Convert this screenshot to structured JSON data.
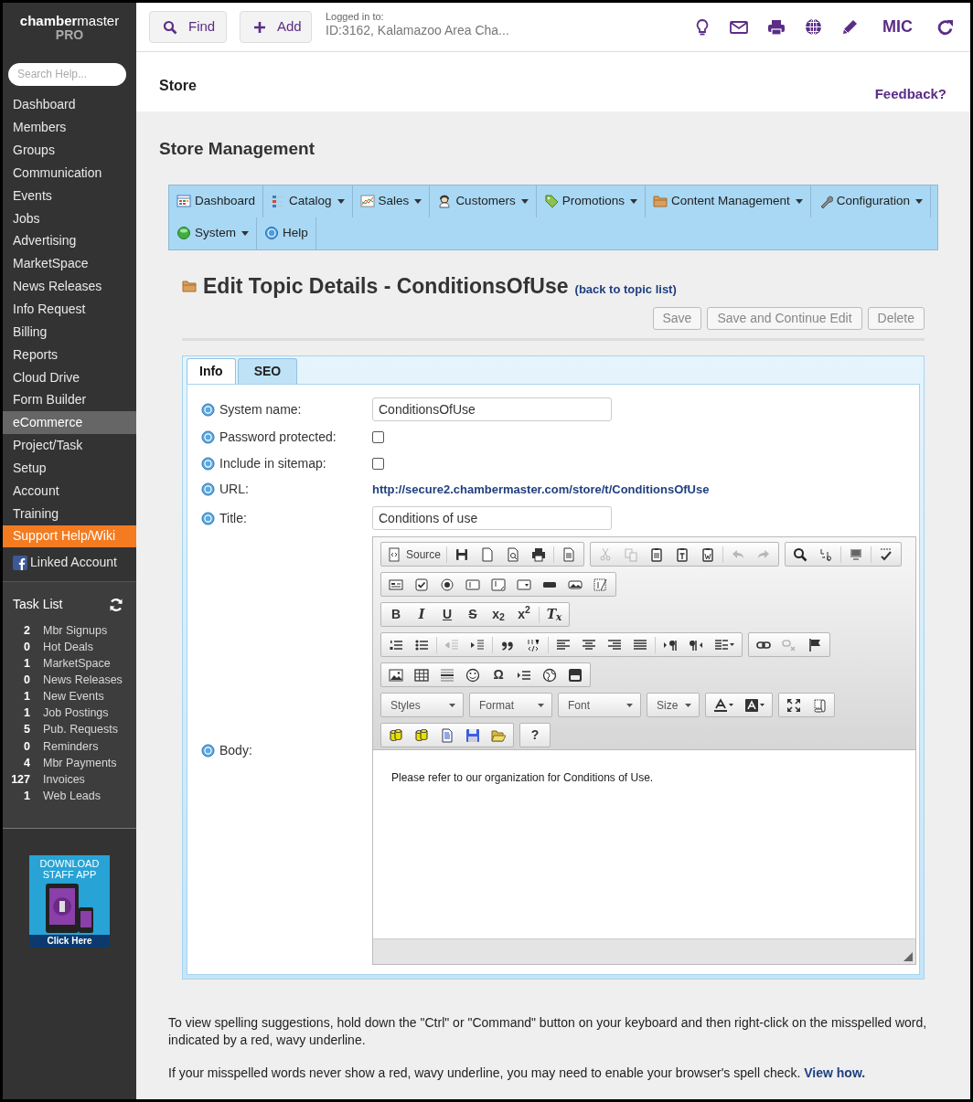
{
  "sidebar": {
    "logo": {
      "brand_bold": "chamber",
      "brand_rest": "master",
      "edition": "PRO"
    },
    "search": {
      "placeholder": "Search Help..."
    },
    "items": [
      {
        "label": "Dashboard",
        "kind": "link",
        "selected": false
      },
      {
        "label": "Members",
        "kind": "link",
        "selected": false
      },
      {
        "label": "Groups",
        "kind": "link",
        "selected": false
      },
      {
        "label": "Communication",
        "kind": "link",
        "selected": false
      },
      {
        "label": "Events",
        "kind": "link",
        "selected": false
      },
      {
        "label": "Jobs",
        "kind": "link",
        "selected": false
      },
      {
        "label": "Advertising",
        "kind": "link",
        "selected": false
      },
      {
        "label": "MarketSpace",
        "kind": "link",
        "selected": false
      },
      {
        "label": "News Releases",
        "kind": "link",
        "selected": false
      },
      {
        "label": "Info Request",
        "kind": "link",
        "selected": false
      },
      {
        "label": "Billing",
        "kind": "link",
        "selected": false
      },
      {
        "label": "Reports",
        "kind": "link",
        "selected": false
      },
      {
        "label": "Cloud Drive",
        "kind": "link",
        "selected": false
      },
      {
        "label": "Form Builder",
        "kind": "link",
        "selected": false
      },
      {
        "label": "eCommerce",
        "kind": "link",
        "selected": true
      },
      {
        "label": "Project/Task",
        "kind": "link",
        "selected": false
      },
      {
        "label": "Setup",
        "kind": "link",
        "selected": false
      },
      {
        "label": "Account",
        "kind": "link",
        "selected": false
      },
      {
        "label": "Training",
        "kind": "link",
        "selected": false
      },
      {
        "label": "Support Help/Wiki",
        "kind": "support",
        "selected": false
      },
      {
        "label": "Linked Account",
        "kind": "account",
        "selected": false
      }
    ],
    "task_list": {
      "title": "Task List",
      "tasks": [
        {
          "count": "2",
          "label": "Mbr Signups"
        },
        {
          "count": "0",
          "label": "Hot Deals"
        },
        {
          "count": "1",
          "label": "MarketSpace"
        },
        {
          "count": "0",
          "label": "News Releases"
        },
        {
          "count": "1",
          "label": "New Events"
        },
        {
          "count": "1",
          "label": "Job Postings"
        },
        {
          "count": "5",
          "label": "Pub. Requests"
        },
        {
          "count": "0",
          "label": "Reminders"
        },
        {
          "count": "4",
          "label": "Mbr Payments"
        },
        {
          "count": "127",
          "label": "Invoices"
        },
        {
          "count": "1",
          "label": "Web Leads"
        }
      ]
    },
    "promo": {
      "lines": [
        "DOWNLOAD",
        "STAFF APP"
      ],
      "button": "Click Here"
    }
  },
  "topbar": {
    "buttons": [
      {
        "kind": "find",
        "label": "Find"
      },
      {
        "kind": "add",
        "label": "Add"
      }
    ],
    "login": {
      "label": "Logged in to:",
      "value": "ID:3162, Kalamazoo Area Cha..."
    },
    "user": "MIC"
  },
  "page": {
    "title": "Store",
    "feedback": "Feedback?",
    "section": "Store Management"
  },
  "menu": [
    {
      "kind": "dashboard",
      "label": "Dashboard",
      "has_menu": false
    },
    {
      "kind": "catalog",
      "label": "Catalog",
      "has_menu": true
    },
    {
      "kind": "sales",
      "label": "Sales",
      "has_menu": true
    },
    {
      "kind": "customers",
      "label": "Customers",
      "has_menu": true
    },
    {
      "kind": "promotions",
      "label": "Promotions",
      "has_menu": true
    },
    {
      "kind": "content",
      "label": "Content Management",
      "has_menu": true
    },
    {
      "kind": "configuration",
      "label": "Configuration",
      "has_menu": true
    },
    {
      "kind": "system",
      "label": "System",
      "has_menu": true
    },
    {
      "kind": "help",
      "label": "Help",
      "has_menu": false
    }
  ],
  "editor_page": {
    "title": "Edit Topic Details - ConditionsOfUse",
    "back_link": "(back to topic list)",
    "actions": [
      "Save",
      "Save and Continue Edit",
      "Delete"
    ],
    "tabs": [
      {
        "label": "Info",
        "selected": true
      },
      {
        "label": "SEO",
        "selected": false
      }
    ],
    "fields": [
      {
        "kind": "text",
        "label": "System name:",
        "value": "ConditionsOfUse"
      },
      {
        "kind": "checkbox",
        "label": "Password protected:",
        "checked": false
      },
      {
        "kind": "checkbox",
        "label": "Include in sitemap:",
        "checked": false
      },
      {
        "kind": "link",
        "label": "URL:",
        "value": "http://secure2.chambermaster.com/store/t/ConditionsOfUse"
      },
      {
        "kind": "text",
        "label": "Title:",
        "value": "Conditions of use"
      },
      {
        "kind": "editor",
        "label": "Body:"
      }
    ]
  },
  "editor": {
    "toolbar": [
      [
        [
          {
            "kind": "source",
            "label": "Source",
            "disabled": false
          },
          {
            "kind": "separator"
          },
          {
            "kind": "save",
            "disabled": false
          },
          {
            "kind": "newpage",
            "disabled": false
          },
          {
            "kind": "preview",
            "disabled": false
          },
          {
            "kind": "print",
            "disabled": false
          },
          {
            "kind": "separator"
          },
          {
            "kind": "templates",
            "disabled": false
          }
        ],
        [
          {
            "kind": "cut",
            "disabled": true
          },
          {
            "kind": "copy",
            "disabled": true
          },
          {
            "kind": "paste",
            "disabled": false
          },
          {
            "kind": "pastetext",
            "disabled": false
          },
          {
            "kind": "pasteword",
            "disabled": false
          },
          {
            "kind": "separator"
          },
          {
            "kind": "undo",
            "disabled": true
          },
          {
            "kind": "redo",
            "disabled": true
          }
        ],
        [
          {
            "kind": "find",
            "disabled": false
          },
          {
            "kind": "replace",
            "disabled": false
          },
          {
            "kind": "separator"
          },
          {
            "kind": "selectall",
            "disabled": false
          },
          {
            "kind": "separator"
          },
          {
            "kind": "spellcheck",
            "disabled": false
          }
        ]
      ],
      [
        [
          {
            "kind": "form",
            "disabled": false
          },
          {
            "kind": "checkbox",
            "disabled": false
          },
          {
            "kind": "radio",
            "disabled": false
          },
          {
            "kind": "textfield",
            "disabled": false
          },
          {
            "kind": "textarea",
            "disabled": false
          },
          {
            "kind": "select",
            "disabled": false
          },
          {
            "kind": "button",
            "disabled": false
          },
          {
            "kind": "imagebutton",
            "disabled": false
          },
          {
            "kind": "hiddenfield",
            "disabled": false
          }
        ]
      ],
      [
        [
          {
            "kind": "bold",
            "glyph": "B",
            "disabled": false
          },
          {
            "kind": "italic",
            "glyph": "I",
            "disabled": false
          },
          {
            "kind": "underline",
            "glyph": "U",
            "disabled": false
          },
          {
            "kind": "strike",
            "glyph": "S",
            "disabled": false
          },
          {
            "kind": "subscript",
            "glyph": "x$_{2}$",
            "disabled": false
          },
          {
            "kind": "superscript",
            "glyph": "x$^{2}$",
            "disabled": false
          },
          {
            "kind": "separator"
          },
          {
            "kind": "removeformat",
            "glyph": "T$_{x}$",
            "disabled": false
          }
        ]
      ],
      [
        [
          {
            "kind": "numlist",
            "disabled": false
          },
          {
            "kind": "bulletlist",
            "disabled": false
          },
          {
            "kind": "separator"
          },
          {
            "kind": "outdent",
            "disabled": true
          },
          {
            "kind": "indent",
            "disabled": false
          },
          {
            "kind": "separator"
          },
          {
            "kind": "blockquote",
            "disabled": false
          },
          {
            "kind": "creatediv",
            "disabled": false
          },
          {
            "kind": "separator"
          },
          {
            "kind": "alignleft",
            "disabled": false
          },
          {
            "kind": "aligncenter",
            "disabled": false
          },
          {
            "kind": "alignright",
            "disabled": false
          },
          {
            "kind": "justify",
            "disabled": false
          },
          {
            "kind": "separator"
          },
          {
            "kind": "ltr",
            "disabled": false
          },
          {
            "kind": "rtl",
            "disabled": false
          },
          {
            "kind": "language",
            "disabled": false
          }
        ],
        [
          {
            "kind": "link",
            "disabled": false
          },
          {
            "kind": "unlink",
            "disabled": true
          },
          {
            "kind": "anchor",
            "disabled": false
          }
        ]
      ],
      [
        [
          {
            "kind": "image",
            "disabled": false
          },
          {
            "kind": "table",
            "disabled": false
          },
          {
            "kind": "hr",
            "disabled": false
          },
          {
            "kind": "smiley",
            "disabled": false
          },
          {
            "kind": "specialchar",
            "glyph": "Ω",
            "disabled": false
          },
          {
            "kind": "pagebreak",
            "disabled": false
          },
          {
            "kind": "iframe",
            "disabled": false
          },
          {
            "kind": "youtube",
            "disabled": false
          }
        ]
      ],
      [
        [
          {
            "kind": "combo",
            "label": "Styles"
          }
        ],
        [
          {
            "kind": "combo",
            "label": "Format"
          }
        ],
        [
          {
            "kind": "combo",
            "label": "Font"
          }
        ],
        [
          {
            "kind": "combo",
            "label": "Size"
          }
        ],
        [
          {
            "kind": "textcolor",
            "disabled": false
          },
          {
            "kind": "bgcolor",
            "disabled": false
          }
        ],
        [
          {
            "kind": "maximize",
            "disabled": false
          },
          {
            "kind": "showblocks",
            "disabled": false
          }
        ]
      ],
      [
        [
          {
            "kind": "cylinder",
            "disabled": false
          },
          {
            "kind": "cylinder",
            "disabled": false
          },
          {
            "kind": "document",
            "disabled": false
          },
          {
            "kind": "floppy",
            "disabled": false
          },
          {
            "kind": "folder",
            "disabled": false
          }
        ],
        [
          {
            "kind": "about",
            "glyph": "?",
            "disabled": false
          }
        ]
      ]
    ],
    "content": "Please refer to our organization for Conditions of Use."
  },
  "notes": [
    {
      "text": "To view spelling suggestions, hold down the \"Ctrl\" or \"Command\" button on your keyboard and then right-click on the misspelled word, indicated by a red, wavy underline."
    },
    {
      "text": "If your misspelled words never show a red, wavy underline, you may need to enable your browser's spell check.",
      "link": "View how."
    }
  ]
}
